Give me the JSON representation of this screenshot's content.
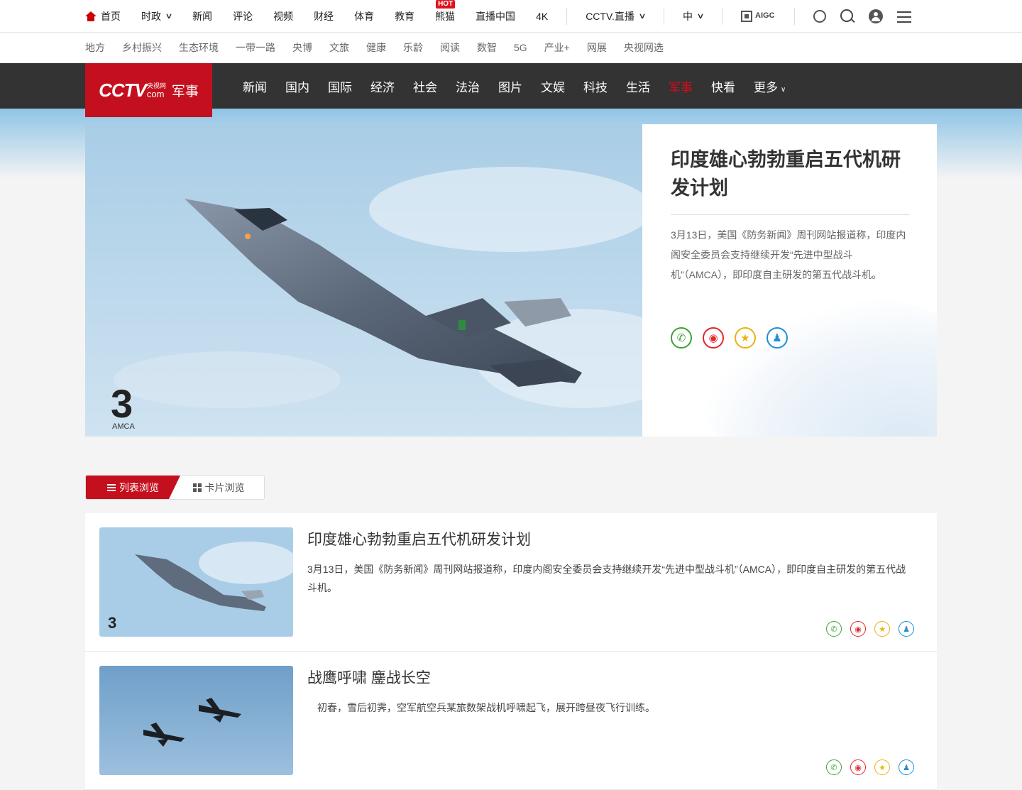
{
  "topnav": {
    "items": [
      {
        "label": "首页",
        "icon": "home-icon"
      },
      {
        "label": "时政",
        "dropdown": true
      },
      {
        "label": "新闻"
      },
      {
        "label": "评论"
      },
      {
        "label": "视频"
      },
      {
        "label": "财经"
      },
      {
        "label": "体育"
      },
      {
        "label": "教育"
      },
      {
        "label": "熊猫",
        "badge": "HOT"
      },
      {
        "label": "直播中国"
      },
      {
        "label": "4K"
      }
    ],
    "live_label": "CCTV.直播",
    "lang_label": "中",
    "aigc_label": "AIGC"
  },
  "subnav": [
    "地方",
    "乡村振兴",
    "生态环境",
    "一带一路",
    "央博",
    "文旅",
    "健康",
    "乐龄",
    "阅读",
    "数智",
    "5G",
    "产业+",
    "网展",
    "央视网选"
  ],
  "brand": {
    "logo_text": "CCTV",
    "logo_cn": "央视网",
    "logo_com": "com",
    "section": "军事",
    "accent": "#c4101e"
  },
  "channels": [
    "新闻",
    "国内",
    "国际",
    "经济",
    "社会",
    "法治",
    "图片",
    "文娱",
    "科技",
    "生活",
    "军事",
    "快看",
    "更多"
  ],
  "active_channel": "军事",
  "hero": {
    "title": "印度雄心勃勃重启五代机研发计划",
    "desc": "3月13日，美国《防务新闻》周刊网站报道称，印度内阁安全委员会支持继续开发“先进中型战斗机”（AMCA），即印度自主研发的第五代战斗机。",
    "image_caption": "AMCA"
  },
  "view_toggle": {
    "list": "列表浏览",
    "card": "卡片浏览"
  },
  "articles": [
    {
      "title": "印度雄心勃勃重启五代机研发计划",
      "desc": "3月13日，美国《防务新闻》周刊网站报道称，印度内阁安全委员会支持继续开发“先进中型战斗机”（AMCA），即印度自主研发的第五代战斗机。"
    },
    {
      "title": "战鹰呼啸 鏖战长空",
      "desc": "　初春，雪后初霁，空军航空兵某旅数架战机呼啸起飞，展开跨昼夜飞行训练。"
    }
  ],
  "share_icons": [
    "wechat-icon",
    "weibo-icon",
    "favorite-icon",
    "qq-icon"
  ]
}
